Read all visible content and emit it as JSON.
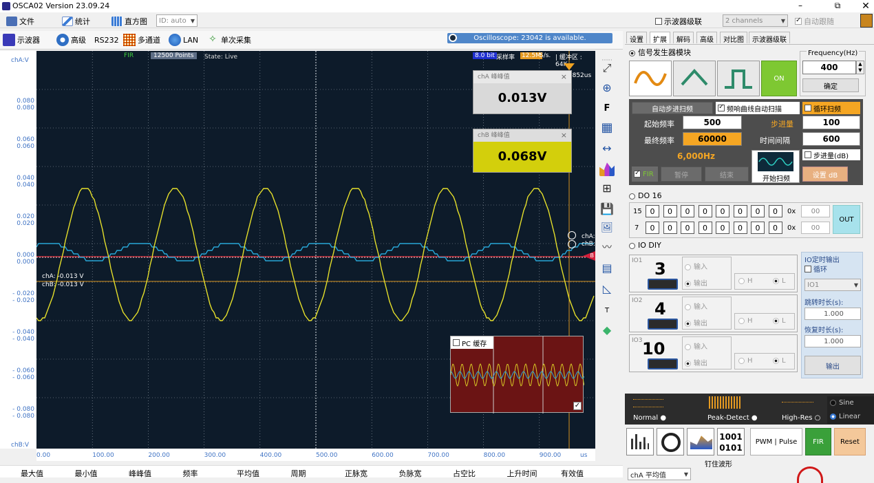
{
  "window": {
    "title": "OSCA02  Version 23.09.24"
  },
  "menu": {
    "file": "文件",
    "stats": "统计",
    "histogram": "直方图",
    "id_combo": "ID: auto",
    "cascade_label": "示波器级联",
    "channels_combo": "2 channels",
    "auto_follow": "自动跟随"
  },
  "toolbar": {
    "oscilloscope": "示波器",
    "advanced": "高级",
    "rs232": "RS232",
    "multichannel": "多通道",
    "lan": "LAN",
    "single": "单次采集",
    "status": "Oscilloscope: 23042 is available."
  },
  "scope": {
    "fir": "FIR",
    "points": "12500 Points",
    "state": "State: Live",
    "bits": "8.0 bit",
    "rate_label": "采样率",
    "rate": "12.5M",
    "rate_unit": "S/s.",
    "buffer": "| 缓冲区 : 64K",
    "time_mark": "5.852us",
    "cha_readout": "chA: -0.013 V",
    "chb_readout": "chB: -0.013 V",
    "marker_a": "chA:",
    "marker_b": "chB:",
    "marker_flag": "B",
    "cha_card": {
      "title": "chA 峰峰值",
      "value": "0.013V",
      "close": "×"
    },
    "chb_card": {
      "title": "chB 峰峰值",
      "value": "0.068V",
      "close": "×"
    },
    "pc_buffer": "PC 缓存"
  },
  "yaxis": {
    "top_label": "chA:V",
    "bottom_label": "chB:V",
    "ticks": [
      {
        "a": "0.080",
        "b": "0.080"
      },
      {
        "a": "0.060",
        "b": "0.060"
      },
      {
        "a": "0.040",
        "b": "0.040"
      },
      {
        "a": "0.020",
        "b": "0.020"
      },
      {
        "a": "0.000",
        "b": "0.000"
      },
      {
        "a": "- 0.020",
        "b": "- 0.020"
      },
      {
        "a": "- 0.040",
        "b": "- 0.040"
      },
      {
        "a": "- 0.060",
        "b": "- 0.060"
      },
      {
        "a": "- 0.080",
        "b": "- 0.080"
      }
    ]
  },
  "xaxis": {
    "ticks": [
      "0.00",
      "100.00",
      "200.00",
      "300.00",
      "400.00",
      "500.00",
      "600.00",
      "700.00",
      "800.00",
      "900.00"
    ],
    "unit": "us"
  },
  "measurements": [
    "最大值",
    "最小值",
    "峰峰值",
    "频率",
    "平均值",
    "周期",
    "正脉宽",
    "负脉宽",
    "占空比",
    "上升时间",
    "有效值"
  ],
  "icons": {
    "fit": "fit-screen-icon",
    "zoom": "zoom-in-icon",
    "f": "F",
    "t": "T"
  },
  "panel": {
    "tabs": [
      "设置",
      "扩展",
      "解码",
      "高级",
      "对比图",
      "示波器级联"
    ],
    "siggen": {
      "title": "信号发生器模块",
      "freq_title": "Frequency(Hz)",
      "freq_value": "400",
      "confirm": "确定",
      "on": "ON",
      "auto_step": "自动步进扫频",
      "auto_scan": "频响曲线自动扫描",
      "loop_scan": "循环扫频",
      "start_label": "起始频率",
      "start_value": "500",
      "step_label": "步进量",
      "step_value": "100",
      "end_label": "最终频率",
      "end_value": "60000",
      "interval_label": "时间间隔",
      "interval_value": "600",
      "freq_display": "6,000Hz",
      "step_db": "步进量(dB)",
      "fir": "FIR",
      "pause": "暂停",
      "stop": "结束",
      "start_scan": "开始扫频",
      "set_db": "设置 dB"
    },
    "do16": {
      "title": "DO 16",
      "row1_label": "15",
      "row2_label": "7",
      "row1_bits": [
        "0",
        "0",
        "0",
        "0",
        "0",
        "0",
        "0",
        "0"
      ],
      "row2_bits": [
        "0",
        "0",
        "0",
        "0",
        "0",
        "0",
        "0",
        "0"
      ],
      "hex_prefix": "0x",
      "row1_hex": "00",
      "row2_hex": "00",
      "out": "OUT"
    },
    "iodiy": {
      "title": "IO DIY",
      "ios": [
        {
          "tag": "IO1",
          "num": "3"
        },
        {
          "tag": "IO2",
          "num": "4"
        },
        {
          "tag": "IO3",
          "num": "10"
        }
      ],
      "input": "输入",
      "output": "输出",
      "h": "H",
      "l": "L",
      "timed_output": "IO定时输出",
      "loop": "循环",
      "io_combo": "IO1",
      "jump_label": "跳转时长(s):",
      "jump_value": "1.000",
      "recover_label": "恢复时长(s):",
      "recover_value": "1.000",
      "output_btn": "输出"
    },
    "acq": {
      "normal": "Normal",
      "peak": "Peak-Detect",
      "hires": "High-Res",
      "sine": "Sine",
      "linear": "Linear"
    },
    "bottom": {
      "pwm": "PWM | Pulse",
      "fir": "FIR",
      "reset": "Reset",
      "cha_avg": "chA 平均值",
      "pin_wave": "钉住波形"
    }
  }
}
